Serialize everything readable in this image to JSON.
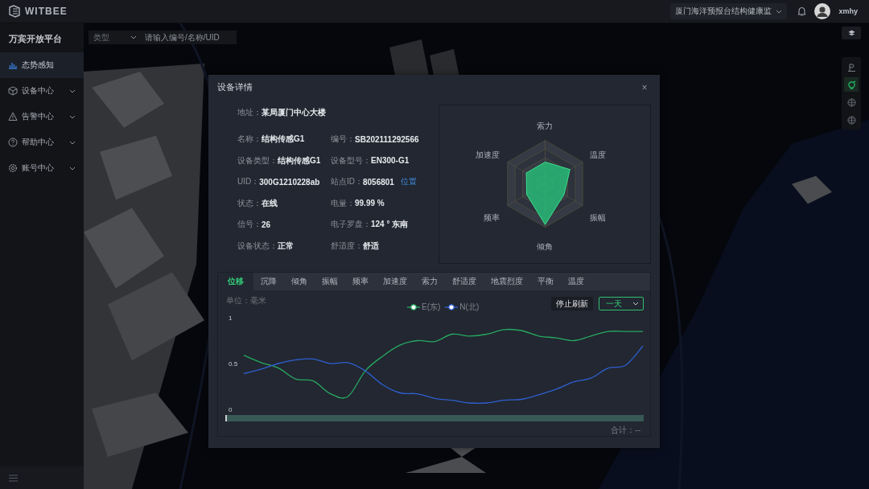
{
  "topbar": {
    "brand": "WITBEE",
    "project": "厦门海洋预报台结构健康监",
    "user": "xmhy"
  },
  "sidebar": {
    "title": "万宾开放平台",
    "items": [
      {
        "label": "态势感知",
        "kind": "chart",
        "selected": true,
        "expandable": false
      },
      {
        "label": "设备中心",
        "kind": "cube",
        "selected": false,
        "expandable": true
      },
      {
        "label": "告警中心",
        "kind": "warning",
        "selected": false,
        "expandable": true
      },
      {
        "label": "帮助中心",
        "kind": "help",
        "selected": false,
        "expandable": true
      },
      {
        "label": "账号中心",
        "kind": "gear",
        "selected": false,
        "expandable": true
      }
    ]
  },
  "map": {
    "kind": "picture",
    "filter": {
      "type_label": "类型",
      "placeholder": "请输入编号/名称/UID"
    },
    "tools": [
      {
        "kind": "tower",
        "selected": false
      },
      {
        "kind": "sprout",
        "selected": true
      },
      {
        "kind": "globe",
        "selected": false
      },
      {
        "kind": "globe",
        "selected": false
      }
    ]
  },
  "dialog": {
    "title": "设备详情",
    "close": "×",
    "address": {
      "label": "地址：",
      "value": "某局厦门中心大楼"
    },
    "fields": [
      {
        "label": "名称：",
        "value": "结构传感G1"
      },
      {
        "label": "编号：",
        "value": "SB202111292566"
      },
      {
        "label": "设备类型：",
        "value": "结构传感G1"
      },
      {
        "label": "设备型号：",
        "value": "EN300-G1"
      },
      {
        "label": "UID：",
        "value": "300G1210228ab"
      },
      {
        "label": "站点ID：",
        "value": "8056801",
        "link": "位置"
      },
      {
        "label": "状态：",
        "value": "在线"
      },
      {
        "label": "电量：",
        "value": "99.99 %"
      },
      {
        "label": "信号：",
        "value": "26"
      },
      {
        "label": "电子罗盘：",
        "value": "124 ° 东南"
      },
      {
        "label": "设备状态：",
        "value": "正常"
      },
      {
        "label": "舒适度：",
        "value": "舒适"
      }
    ],
    "radar": {
      "axes": [
        "索力",
        "温度",
        "振幅",
        "倾角",
        "频率",
        "加速度"
      ]
    },
    "tabs": [
      {
        "label": "位移",
        "selected": true
      },
      {
        "label": "沉降",
        "selected": false
      },
      {
        "label": "倾角",
        "selected": false
      },
      {
        "label": "振幅",
        "selected": false
      },
      {
        "label": "频率",
        "selected": false
      },
      {
        "label": "加速度",
        "selected": false
      },
      {
        "label": "索力",
        "selected": false
      },
      {
        "label": "舒适度",
        "selected": false
      },
      {
        "label": "地震烈度",
        "selected": false
      },
      {
        "label": "平衡",
        "selected": false
      },
      {
        "label": "温度",
        "selected": false
      }
    ],
    "unit": "单位：毫米",
    "stop_button": "停止刷新",
    "range": "一天",
    "chart_data": {
      "type": "line",
      "ylim": [
        0,
        1
      ],
      "yticks": [
        0,
        0.5,
        1
      ],
      "series": [
        {
          "name": "E(东)",
          "color": "#27a861",
          "values": [
            0.59,
            0.51,
            0.45,
            0.33,
            0.31,
            0.17,
            0.14,
            0.42,
            0.58,
            0.7,
            0.75,
            0.74,
            0.82,
            0.8,
            0.82,
            0.87,
            0.86,
            0.8,
            0.78,
            0.75,
            0.8,
            0.85,
            0.85,
            0.85
          ]
        },
        {
          "name": "N(北)",
          "color": "#2f5fd0",
          "values": [
            0.39,
            0.44,
            0.5,
            0.54,
            0.55,
            0.5,
            0.51,
            0.42,
            0.27,
            0.18,
            0.17,
            0.12,
            0.1,
            0.07,
            0.07,
            0.1,
            0.11,
            0.16,
            0.22,
            0.3,
            0.34,
            0.45,
            0.48,
            0.69
          ]
        }
      ]
    },
    "slider": {
      "level": 1
    },
    "total": "合计：--"
  }
}
